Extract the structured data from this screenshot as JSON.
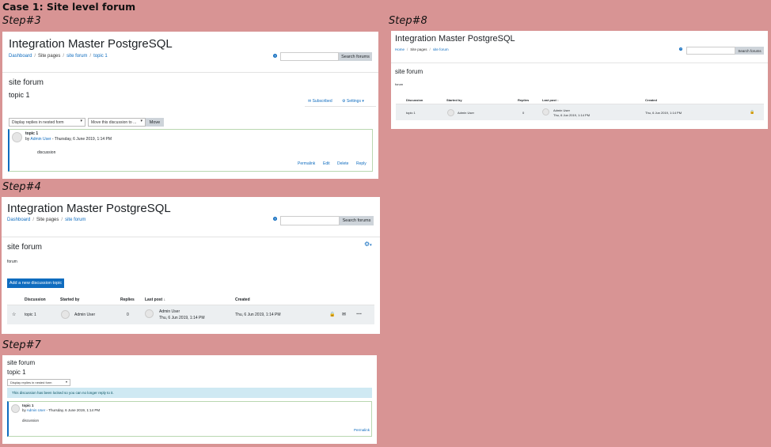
{
  "case_title": "Case 1: Site level forum",
  "steps": {
    "s3": "Step#3",
    "s4": "Step#4",
    "s7": "Step#7",
    "s8": "Step#8"
  },
  "site_title": "Integration Master PostgreSQL",
  "search_button": "Search forums",
  "help_icon": "?",
  "breadcrumb": {
    "dashboard": "Dashboard",
    "home": "Home",
    "site_pages": "Site pages",
    "site_forum": "site forum",
    "topic": "topic 1"
  },
  "forum_name": "site forum",
  "discussion_name": "topic 1",
  "step3": {
    "subscribed": "Subscribed",
    "settings": "Settings",
    "display_mode": "Display replies in nested form",
    "move_select": "Move this discussion to ...",
    "move_button": "Move",
    "post_subject": "topic 1",
    "post_by_prefix": "by",
    "post_author": "Admin User",
    "post_date": "- Thursday, 6 June 2019, 1:14 PM",
    "post_body": "discussion",
    "actions": [
      "Permalink",
      "Edit",
      "Delete",
      "Reply"
    ]
  },
  "step4": {
    "intro": "forum",
    "add_button": "Add a new discussion topic",
    "columns": {
      "discussion": "Discussion",
      "started_by": "Started by",
      "replies": "Replies",
      "last_post": "Last post",
      "created": "Created"
    },
    "row": {
      "discussion": "topic 1",
      "started_by": "Admin User",
      "replies": "0",
      "last_post_user": "Admin User",
      "last_post_date": "Thu, 6 Jun 2019, 1:14 PM",
      "created": "Thu, 6 Jun 2019, 1:14 PM"
    }
  },
  "step7": {
    "display_mode": "Display replies in nested form",
    "locked_notice": "This discussion has been locked so you can no longer reply to it.",
    "post_subject": "topic 1",
    "post_by_prefix": "by",
    "post_author": "Admin User",
    "post_date": "- Thursday, 6 June 2019, 1:14 PM",
    "post_body": "discussion",
    "permalink": "Permalink"
  },
  "step8": {
    "intro": "forum",
    "columns": {
      "discussion": "Discussion",
      "started_by": "Started by",
      "replies": "Replies",
      "last_post": "Last post",
      "created": "Created"
    },
    "row": {
      "discussion": "topic 1",
      "started_by": "Admin User",
      "replies": "0",
      "last_post_user": "Admin User",
      "last_post_date": "Thu, 6 Jun 2019, 1:14 PM",
      "created": "Thu, 6 Jun 2019, 1:14 PM"
    }
  },
  "colors": {
    "background": "#d89494",
    "link": "#0f6cbf",
    "button": "#0f6cbf",
    "alert": "#cfe9f3"
  }
}
